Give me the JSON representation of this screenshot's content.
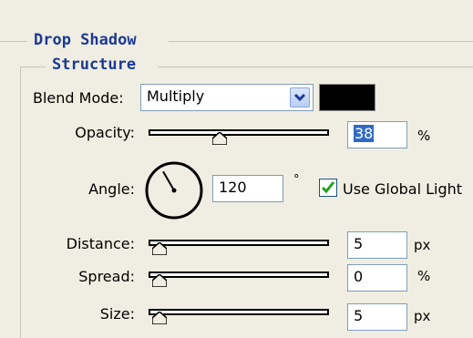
{
  "groups": {
    "outer_title": "Drop Shadow",
    "inner_title": "Structure"
  },
  "blend_mode": {
    "label": "Blend Mode:",
    "value": "Multiply",
    "color": "#000000"
  },
  "opacity": {
    "label": "Opacity:",
    "value": "38",
    "unit": "%",
    "level_percent": 38
  },
  "angle": {
    "label": "Angle:",
    "value": "120",
    "unit": "°",
    "degrees": 120,
    "use_global_light_label": "Use Global Light",
    "use_global_light_checked": true
  },
  "distance": {
    "label": "Distance:",
    "value": "5",
    "unit": "px",
    "level_fraction": 0.0
  },
  "spread": {
    "label": "Spread:",
    "value": "0",
    "unit": "%",
    "level_fraction": 0.0
  },
  "size": {
    "label": "Size:",
    "value": "5",
    "unit": "px",
    "level_fraction": 0.0
  },
  "colors": {
    "title_blue": "#1b3a93",
    "panel_bg": "#f0eee2",
    "selection": "#316ac5"
  }
}
